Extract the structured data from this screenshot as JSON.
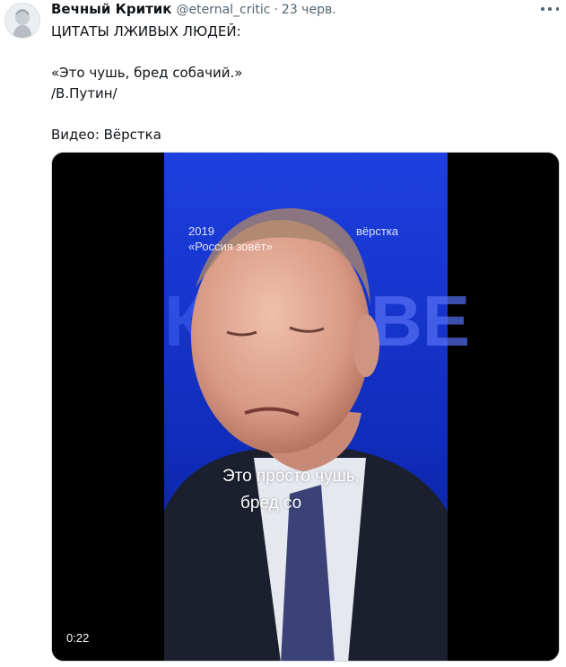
{
  "tweet": {
    "author": {
      "display_name": "Вечный Критик",
      "handle": "@eternal_critic",
      "separator": "·",
      "date": "23 черв."
    },
    "text": {
      "line1": "ЦИТАТЫ ЛЖИВЫХ ЛЮДЕЙ:",
      "quote": "«Это чушь, бред собачий.»",
      "attribution": "/В.Путин/",
      "credit": "Видео: Вёрстка"
    }
  },
  "video": {
    "overlay": {
      "year": "2019",
      "event": "«Россия зовёт»",
      "brand": "вёрстка"
    },
    "subtitles": {
      "line1": "Это просто чушь,",
      "line2": "бред со"
    },
    "duration": "0:22"
  },
  "icons": {
    "avatar": "statue-avatar",
    "more": "more-icon"
  },
  "colors": {
    "stage_blue": "#1a3bdc",
    "text_primary": "#0f1419",
    "text_secondary": "#536471"
  }
}
